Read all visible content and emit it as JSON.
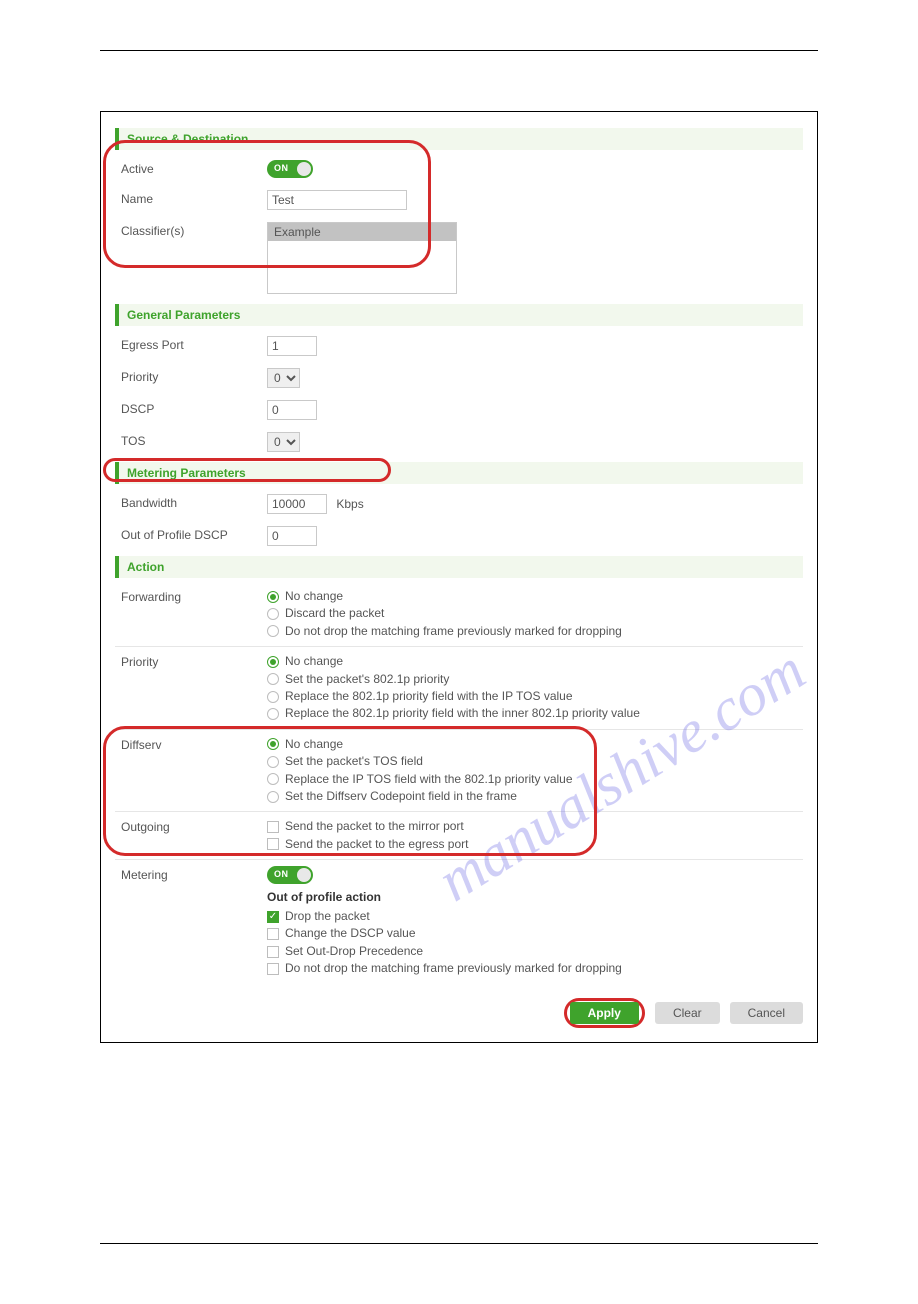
{
  "watermark_text": "manualshive.com",
  "sections": {
    "source_dest": "Source & Destination",
    "general": "General Parameters",
    "metering": "Metering Parameters",
    "action": "Action"
  },
  "sd": {
    "active_label": "Active",
    "active_toggle": "ON",
    "name_label": "Name",
    "name_value": "Test",
    "classifiers_label": "Classifier(s)",
    "classifier_option": "Example"
  },
  "gp": {
    "egress_label": "Egress Port",
    "egress_value": "1",
    "priority_label": "Priority",
    "priority_value": "0",
    "dscp_label": "DSCP",
    "dscp_value": "0",
    "tos_label": "TOS",
    "tos_value": "0"
  },
  "mp": {
    "bw_label": "Bandwidth",
    "bw_value": "10000",
    "bw_unit": "Kbps",
    "oop_dscp_label": "Out of Profile DSCP",
    "oop_dscp_value": "0"
  },
  "action": {
    "forwarding": {
      "label": "Forwarding",
      "opt1": "No change",
      "opt2": "Discard the packet",
      "opt3": "Do not drop the matching frame previously marked for dropping"
    },
    "priority": {
      "label": "Priority",
      "opt1": "No change",
      "opt2": "Set the packet's 802.1p priority",
      "opt3": "Replace the 802.1p priority field with the IP TOS value",
      "opt4": "Replace the 802.1p priority field with the inner 802.1p priority value"
    },
    "diffserv": {
      "label": "Diffserv",
      "opt1": "No change",
      "opt2": "Set the packet's TOS field",
      "opt3": "Replace the IP TOS field with the 802.1p priority value",
      "opt4": "Set the Diffserv Codepoint field in the frame"
    },
    "outgoing": {
      "label": "Outgoing",
      "opt1": "Send the packet to the mirror port",
      "opt2": "Send the packet to the egress port"
    },
    "metering": {
      "label": "Metering",
      "toggle": "ON",
      "oop_title": "Out of profile action",
      "c1": "Drop the packet",
      "c2": "Change the DSCP value",
      "c3": "Set Out-Drop Precedence",
      "c4": "Do not drop the matching frame previously marked for dropping"
    }
  },
  "buttons": {
    "apply": "Apply",
    "clear": "Clear",
    "cancel": "Cancel"
  }
}
